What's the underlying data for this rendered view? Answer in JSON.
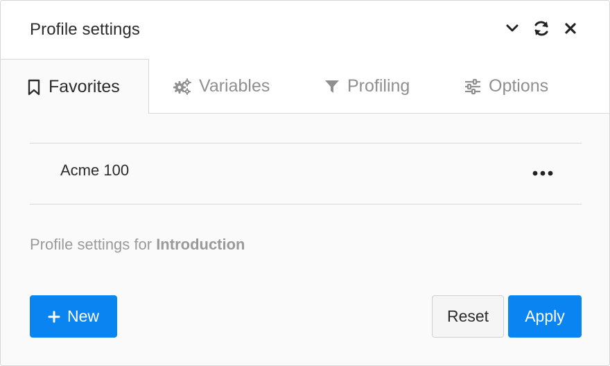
{
  "header": {
    "title": "Profile settings"
  },
  "tabs": [
    {
      "label": "Favorites",
      "icon": "bookmark-icon",
      "active": true
    },
    {
      "label": "Variables",
      "icon": "gears-icon",
      "active": false
    },
    {
      "label": "Profiling",
      "icon": "filter-icon",
      "active": false
    },
    {
      "label": "Options",
      "icon": "sliders-icon",
      "active": false
    }
  ],
  "favorites": {
    "items": [
      {
        "name": "Acme 100"
      }
    ]
  },
  "description": {
    "prefix": "Profile settings for ",
    "target": "Introduction"
  },
  "footer": {
    "new_label": "New",
    "reset_label": "Reset",
    "apply_label": "Apply"
  },
  "colors": {
    "primary": "#0a84f0",
    "text": "#2b2b2b",
    "muted": "#8f8f8f",
    "border": "#d9d9d9"
  }
}
